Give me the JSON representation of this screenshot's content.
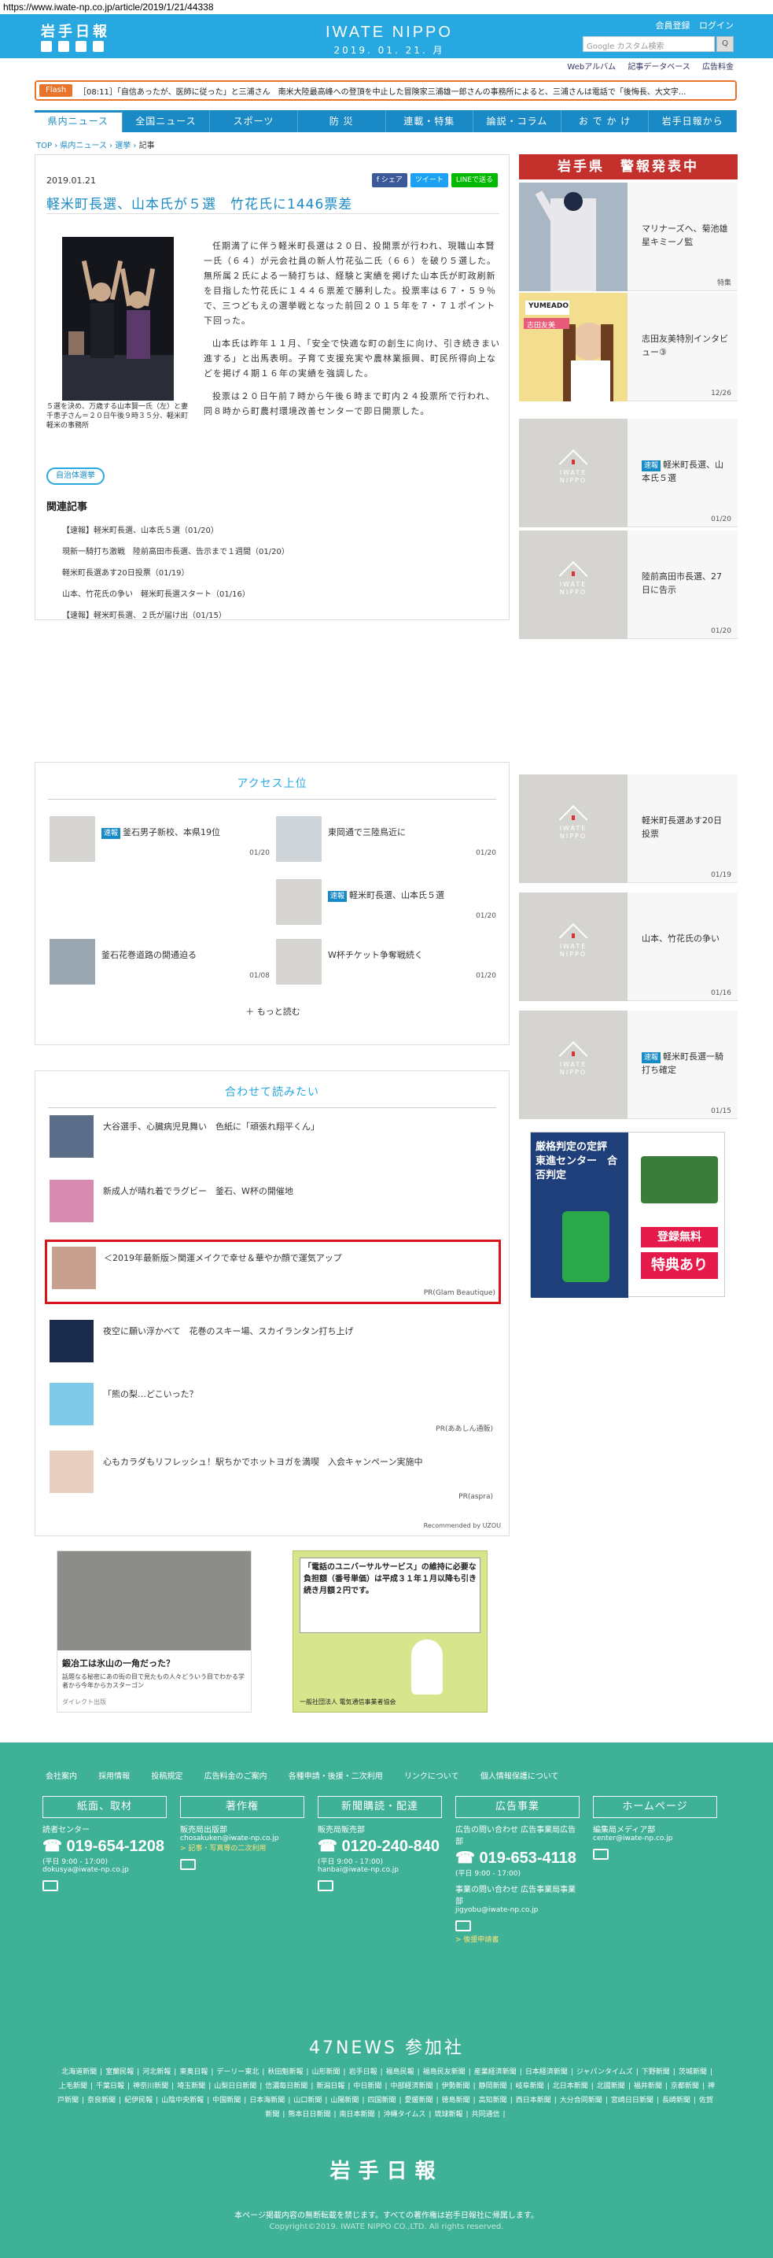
{
  "url": "https://www.iwate-np.co.jp/article/2019/1/21/44338",
  "header": {
    "logo_small": "岩手日報",
    "brand": "IWATE NIPPO",
    "date": "2019. 01. 21. 月",
    "links": [
      "会員登録",
      "ログイン"
    ],
    "search_placeholder": "Google カスタム検索",
    "search_button": "Q",
    "subnav": [
      "Webアルバム",
      "記事データベース",
      "広告料金"
    ]
  },
  "flash": {
    "tag": "Flash",
    "text": "［08:11］「自信あったが、医師に従った」と三浦さん　南米大陸最高峰への登頂を中止した冒険家三浦雄一郎さんの事務所によると、三浦さんは電話で「後悔長、大文字..."
  },
  "mainnav": [
    "県内ニュース",
    "全国ニュース",
    "スポーツ",
    "防 災",
    "連載・特集",
    "論説・コラム",
    "お で か け",
    "岩手日報から"
  ],
  "breadcrumb": [
    "TOP",
    "県内ニュース",
    "選挙",
    "記事"
  ],
  "article": {
    "date": "2019.01.21",
    "share": [
      "f シェア",
      "ツイート",
      "LINEで送る"
    ],
    "title": "軽米町長選、山本氏が５選　竹花氏に1446票差",
    "caption": "５選を決め、万歳する山本賢一氏（左）と妻千恵子さん＝２０日午後９時３５分、軽米町軽米の事務所",
    "paragraphs": [
      "任期満了に伴う軽米町長選は２０日、投開票が行われ、現職山本賢一氏（６４）が元会社員の新人竹花弘二氏（６６）を破り５選した。無所属２氏による一騎打ちは、経験と実績を掲げた山本氏が町政刷新を目指した竹花氏に１４４６票差で勝利した。投票率は６７・５９％で、三つどもえの選挙戦となった前回２０１５年を７・７１ポイント下回った。",
      "山本氏は昨年１１月、「安全で快適な町の創生に向け、引き続きまい進する」と出馬表明。子育て支援充実や農林業振興、町民所得向上などを掲げ４期１６年の実績を強調した。",
      "投票は２０日午前７時から午後６時まで町内２４投票所で行われ、同８時から町農村環境改善センターで即日開票した。"
    ],
    "tag": "自治体選挙",
    "related_heading": "関連記事",
    "related": [
      "【速報】軽米町長選、山本氏５選（01/20）",
      "現新一騎打ち激戦　陸前高田市長選、告示まで１週間（01/20）",
      "軽米町長選あす20日投票（01/19）",
      "山本、竹花氏の争い　軽米町長選スタート（01/16）",
      "【速報】軽米町長選、２氏が届け出（01/15）"
    ]
  },
  "sidebar": {
    "warning": "岩手県　警報発表中",
    "cards_top": [
      {
        "title": "マリナーズへ、菊池雄星キミーノ監",
        "date": "特集"
      },
      {
        "title": "志田友美特別インタビュー③",
        "date": "12/26"
      },
      {
        "badge": "速報",
        "title": "軽米町長選、山本氏５選",
        "date": "01/20"
      },
      {
        "title": "陸前高田市長選、27日に告示",
        "date": "01/20"
      }
    ],
    "cards_bottom": [
      {
        "title": "軽米町長選あす20日投票",
        "date": "01/19"
      },
      {
        "title": "山本、竹花氏の争い",
        "date": "01/16"
      },
      {
        "badge": "速報",
        "title": "軽米町長選一騎打ち確定",
        "date": "01/15"
      }
    ],
    "logo_text": "IWATE NIPPO",
    "promo_badge": "YUMEADO",
    "promo_name": "志田友美"
  },
  "access": {
    "heading": "アクセス上位",
    "items": [
      {
        "badge": "速報",
        "title": "釜石男子新校、本県19位",
        "date": "01/20"
      },
      {
        "title": "東岡通で三陸鳥近に",
        "date": "01/20"
      },
      {
        "badge": "速報",
        "title": "軽米町長選、山本氏５選",
        "date": "01/20"
      },
      {
        "title": "釜石花巻道路の開通迫る",
        "date": "01/08"
      },
      {
        "title": "W杯チケット争奪戦続く",
        "date": "01/20"
      }
    ],
    "more": "＋ もっと読む"
  },
  "recommend": {
    "heading": "合わせて読みたい",
    "items": [
      {
        "title": "大谷選手、心臓病児見舞い　色紙に「頑張れ翔平くん」",
        "pr": ""
      },
      {
        "title": "新成人が晴れ着でラグビー　釜石、W杯の開催地",
        "pr": ""
      },
      {
        "title": "＜2019年最新版＞関運メイクで幸せ＆華やか顔で運気アップ",
        "pr": "PR(Glam Beautique)"
      },
      {
        "title": "夜空に願い浮かべて　花巻のスキー場、スカイランタン打ち上げ",
        "pr": ""
      },
      {
        "title": "「熊の梨…どこいった？",
        "pr": "PR(ああしん通販)"
      },
      {
        "title": "心もカラダもリフレッシュ！駅ちかでホットヨガを満喫　入会キャンペーン実施中",
        "pr": "PR(aspra)"
      }
    ],
    "credit": "Recommended by UZOU"
  },
  "ads": {
    "left_text": "鍛冶工は氷山の一角だった？",
    "left_sub": "話題なる秘密にあの街の目で見たもの人々どういう目でわかる学者から今年からカスターゴン",
    "left_src": "ダイレクト出版",
    "right_text": "「電話のユニバーサルサービス」の維持に必要な負担額（番号単価）は平成３１年１月以降も引き続き月額２円です。",
    "right_sub": "一般社団法人 電気通信事業者協会",
    "exam_title": "厳格判定の定評　東進センター　合否判定",
    "exam_btn": "登録無料",
    "exam_btn2": "特典あり"
  },
  "footer": {
    "links": [
      "会社案内",
      "採用情報",
      "投稿規定",
      "広告料金のご案内",
      "各種申請・後援・二次利用",
      "リンクについて",
      "個人情報保護について"
    ],
    "cols": [
      {
        "head": "紙面、取材",
        "label": "読者センター",
        "phone": "019-654-1208",
        "hours": "(平日 9:00 - 17:00)",
        "mail": "dokusya@iwate-np.co.jp"
      },
      {
        "head": "著作権",
        "label": "販売局出版部",
        "phone": "",
        "hours": "",
        "mail": "chosakuken@iwate-np.co.jp",
        "link": "> 記事・写真等の二次利用"
      },
      {
        "head": "新聞購読・配達",
        "label": "販売局販売部",
        "phone": "0120-240-840",
        "hours": "(平日 9:00 - 17:00)",
        "mail": "hanbai@iwate-np.co.jp"
      },
      {
        "head": "広告事業",
        "label": "広告の問い合わせ 広告事業局広告部",
        "phone": "019-653-4118",
        "hours": "(平日 9:00 - 17:00)",
        "mail": "jigyobu@iwate-np.co.jp",
        "label2": "事業の問い合わせ 広告事業局事業部",
        "link": "> 後援申請書"
      },
      {
        "head": "ホームページ",
        "label": "編集局メディア部",
        "phone": "",
        "hours": "",
        "mail": "center@iwate-np.co.jp"
      }
    ],
    "news47": "47NEWS 参加社",
    "papers": [
      "北海道新聞",
      "室蘭民報",
      "河北新報",
      "東奥日報",
      "デーリー東北",
      "秋田魁新報",
      "山形新聞",
      "岩手日報",
      "福島民報",
      "福島民友新聞",
      "産業経済新聞",
      "日本経済新聞",
      "ジャパンタイムズ",
      "下野新聞",
      "茨城新聞",
      "上毛新聞",
      "千葉日報",
      "神奈川新聞",
      "埼玉新聞",
      "山梨日日新聞",
      "信濃毎日新聞",
      "新潟日報",
      "中日新聞",
      "中部経済新聞",
      "伊勢新聞",
      "静岡新聞",
      "岐阜新聞",
      "北日本新聞",
      "北國新聞",
      "福井新聞",
      "京都新聞",
      "神戸新聞",
      "奈良新聞",
      "紀伊民報",
      "山陰中央新報",
      "中国新聞",
      "日本海新聞",
      "山口新聞",
      "山陽新聞",
      "四国新聞",
      "愛媛新聞",
      "徳島新聞",
      "高知新聞",
      "西日本新聞",
      "大分合同新聞",
      "宮崎日日新聞",
      "長崎新聞",
      "佐賀新聞",
      "熊本日日新聞",
      "南日本新聞",
      "沖縄タイムス",
      "琉球新報",
      "共同通信"
    ],
    "logo": "岩手日報",
    "note": "本ページ掲載内容の無断転載を禁じます。すべての著作権は岩手日報社に帰属します。",
    "copy": "Copyright©2019. IWATE NIPPO CO.,LTD. All rights reserved."
  }
}
